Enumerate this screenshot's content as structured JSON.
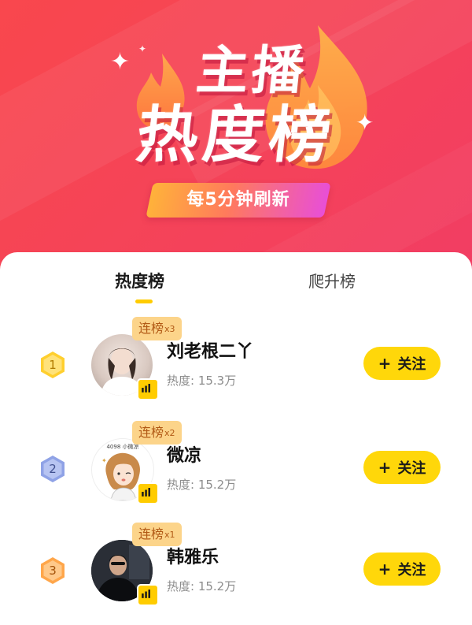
{
  "hero": {
    "title_line1": "主播",
    "title_line2": "热度榜",
    "refresh_text": "每5分钟刷新",
    "sparkle": "✦"
  },
  "tabs": [
    {
      "label": "热度榜",
      "active": true
    },
    {
      "label": "爬升榜",
      "active": false
    }
  ],
  "follow_label": "关注",
  "follow_plus": "+",
  "colors": {
    "hero_red": "#f54457",
    "accent_yellow": "#ffd70a",
    "streak_bg": "#fcd48a",
    "streak_text": "#b25a16",
    "rank1": "#ffcf2e",
    "rank2": "#8fa2e6",
    "rank3": "#ffa64a"
  },
  "rows": [
    {
      "rank": "1",
      "streak_label": "连榜",
      "streak_mult": "x3",
      "name": "刘老根二丫",
      "heat": "热度: 15.3万",
      "rank_icon": "hexagon-gold-icon",
      "level_icon": "signal-bars-icon"
    },
    {
      "rank": "2",
      "streak_label": "连榜",
      "streak_mult": "x2",
      "name": "微凉",
      "heat": "热度: 15.2万",
      "rank_icon": "hexagon-silver-icon",
      "level_icon": "signal-bars-icon"
    },
    {
      "rank": "3",
      "streak_label": "连榜",
      "streak_mult": "x1",
      "name": "韩雅乐",
      "heat": "热度: 15.2万",
      "rank_icon": "hexagon-bronze-icon",
      "level_icon": "signal-bars-icon"
    }
  ],
  "avatar_caption": "4098 小微凉"
}
